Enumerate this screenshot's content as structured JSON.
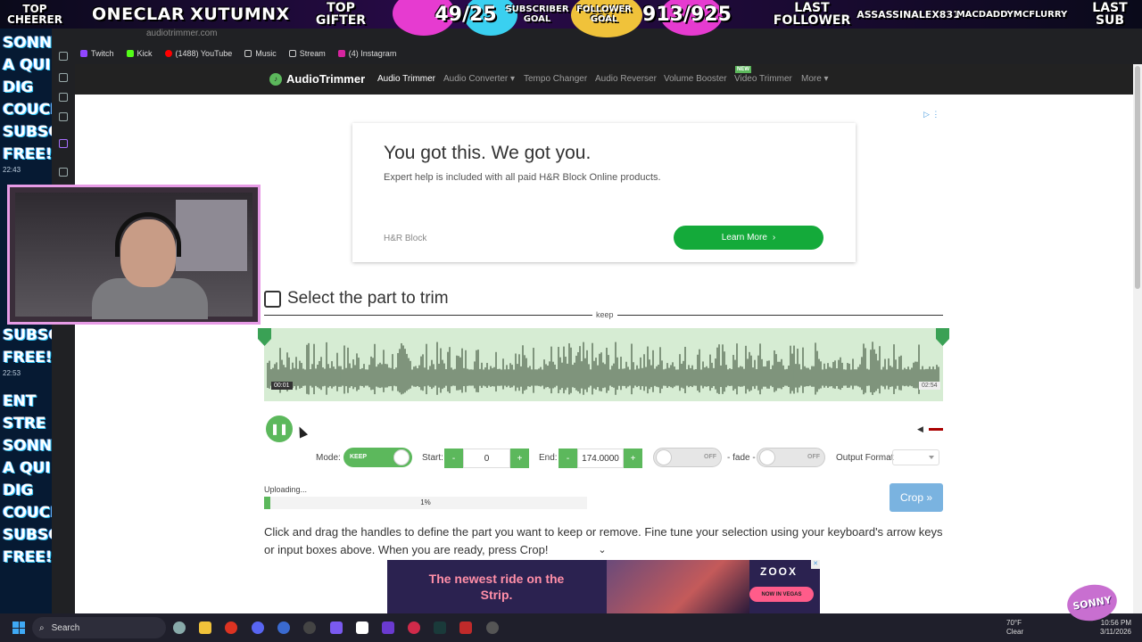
{
  "overlay": {
    "top_cheerer_label": "TOP CHEERER",
    "top_cheerer_name": "ONECLAR",
    "top_gifter_name": "XUTUMNX",
    "top_gifter_label": "TOP GIFTER",
    "sub_goal_count": "49/25",
    "sub_goal_label": "SUBSCRIBER GOAL",
    "follower_goal_label": "FOLLOWER GOAL",
    "follower_goal_count": "913/925",
    "last_follower_label": "LAST FOLLOWER",
    "last_follower_name": "ASSASSINALEX831",
    "last_sub_name": "MACDADDYMCFLURRY",
    "last_sub_label": "LAST SUB"
  },
  "chat": {
    "lines_a": [
      "SONNY",
      "A QUI",
      "DIG",
      "COUCI",
      "SUBSC",
      "FREE!"
    ],
    "time_a": "22:43",
    "lines_b": [
      "SUBSC",
      "FREE!"
    ],
    "time_b": "22:53",
    "lines_c": [
      "ENT",
      "STRE",
      "SONNY",
      "A QUI",
      "DIG",
      "COUCI",
      "SUBSC",
      "FREE!"
    ]
  },
  "browser": {
    "address": "audiotrimmer.com",
    "bookmarks": [
      "Twitch",
      "Kick",
      "(1488) YouTube",
      "Music",
      "Stream",
      "(4) Instagram"
    ]
  },
  "site": {
    "logo": "AudioTrimmer",
    "nav": [
      "Audio Trimmer",
      "Audio Converter ▾",
      "Tempo Changer",
      "Audio Reverser",
      "Volume Booster",
      "Video Trimmer",
      "More ▾"
    ],
    "new_badge": "NEW"
  },
  "ad": {
    "headline": "You got this. We got you.",
    "subtext": "Expert help is included with all paid H&R Block Online products.",
    "brand": "H&R Block",
    "button": "Learn More"
  },
  "trimmer": {
    "title": "Select the part to trim",
    "keep_label": "keep",
    "time_start": "00:01",
    "time_end": "02:54",
    "mode_label": "Mode:",
    "mode_value": "KEEP",
    "start_label": "Start:",
    "start_value": "0",
    "end_label": "End:",
    "end_value": "174.0000",
    "fade_in_state": "OFF",
    "fade_label": "- fade -",
    "fade_out_state": "OFF",
    "output_label": "Output Format",
    "uploading_label": "Uploading...",
    "progress_text": "1%",
    "progress_value": 0.01,
    "crop_button": "Crop »",
    "help_text": "Click and drag the handles to define the part you want to keep or remove. Fine tune your selection using your keyboard's arrow keys or input boxes above. When you are ready, press Crop!"
  },
  "banner": {
    "text": "The newest ride on the Strip.",
    "logo": "ZOOX",
    "cta": "NOW IN VEGAS"
  },
  "taskbar": {
    "search": "Search",
    "weather_temp": "70°F",
    "weather_desc": "Clear",
    "time": "10:56 PM",
    "date": "3/11/2026"
  },
  "badge": "SONNY",
  "colors": {
    "accent_green": "#5cb85c",
    "wave_fill": "#d6ecd3",
    "wave_dark": "#5a6e57",
    "crop_blue": "#7ab3e0",
    "webcam_border": "#e79be6"
  }
}
